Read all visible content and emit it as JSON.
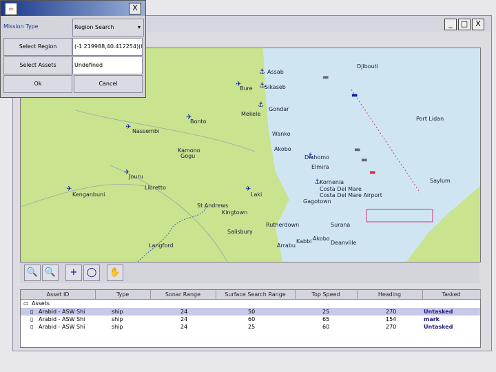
{
  "dialog": {
    "mission_type_label": "Mission Type",
    "mission_type_value": "Region Search",
    "select_region_label": "Select Region",
    "region_value": "(-1.219988,40.412254)(0",
    "select_assets_label": "Select Assets",
    "assets_value": "Undefined",
    "ok_label": "Ok",
    "cancel_label": "Cancel"
  },
  "window": {
    "min": "_",
    "max": "□",
    "close": "X"
  },
  "map": {
    "places": [
      {
        "name": "Djibouti"
      },
      {
        "name": "Assab"
      },
      {
        "name": "Bure"
      },
      {
        "name": "Sikaseb"
      },
      {
        "name": "Gondar"
      },
      {
        "name": "Mekele"
      },
      {
        "name": "Port Lidan"
      },
      {
        "name": "Nassembi"
      },
      {
        "name": "Bonto"
      },
      {
        "name": "Wanko"
      },
      {
        "name": "Akobo"
      },
      {
        "name": "Kamono"
      },
      {
        "name": "Gogu"
      },
      {
        "name": "Diahomo"
      },
      {
        "name": "Elmira"
      },
      {
        "name": "Jouru"
      },
      {
        "name": "Libretto"
      },
      {
        "name": "Kenganbuni"
      },
      {
        "name": "Laki"
      },
      {
        "name": "Kornenia"
      },
      {
        "name": "Costa Del Mare"
      },
      {
        "name": "Costa Del Mare Airport"
      },
      {
        "name": "Gagotown"
      },
      {
        "name": "Saylum"
      },
      {
        "name": "St Andrews"
      },
      {
        "name": "Kingtown"
      },
      {
        "name": "Rutherdown"
      },
      {
        "name": "Salisbury"
      },
      {
        "name": "Surana"
      },
      {
        "name": "Langford"
      },
      {
        "name": "Akobo"
      },
      {
        "name": "Deanville"
      },
      {
        "name": "Kabbi"
      },
      {
        "name": "Arrabu"
      }
    ]
  },
  "toolbar": {
    "zoom_in": "🔍",
    "zoom_out": "🔍",
    "add": "+",
    "circle": "◯",
    "pan": "✋"
  },
  "table": {
    "headers": [
      "Asset ID",
      "Type",
      "Sonar Range",
      "Surface Search Range",
      "Top Speed",
      "Heading",
      "Tasked"
    ],
    "root_label": "Assets",
    "rows": [
      {
        "id": "Arabid - ASW Shi",
        "type": "ship",
        "sonar": "24",
        "surface": "50",
        "speed": "25",
        "heading": "270",
        "tasked": "Untasked"
      },
      {
        "id": "Arabid - ASW Shi",
        "type": "ship",
        "sonar": "24",
        "surface": "60",
        "speed": "65",
        "heading": "154",
        "tasked": "mark"
      },
      {
        "id": "Arabid - ASW Shi",
        "type": "ship",
        "sonar": "24",
        "surface": "25",
        "speed": "60",
        "heading": "270",
        "tasked": "Untasked"
      }
    ]
  },
  "colors": {
    "land": "#c9e38f",
    "sea": "#cfe6f2",
    "title": "#1a3a8a",
    "asset": "#0a1fa8",
    "tasked": "#1c1c7a"
  }
}
